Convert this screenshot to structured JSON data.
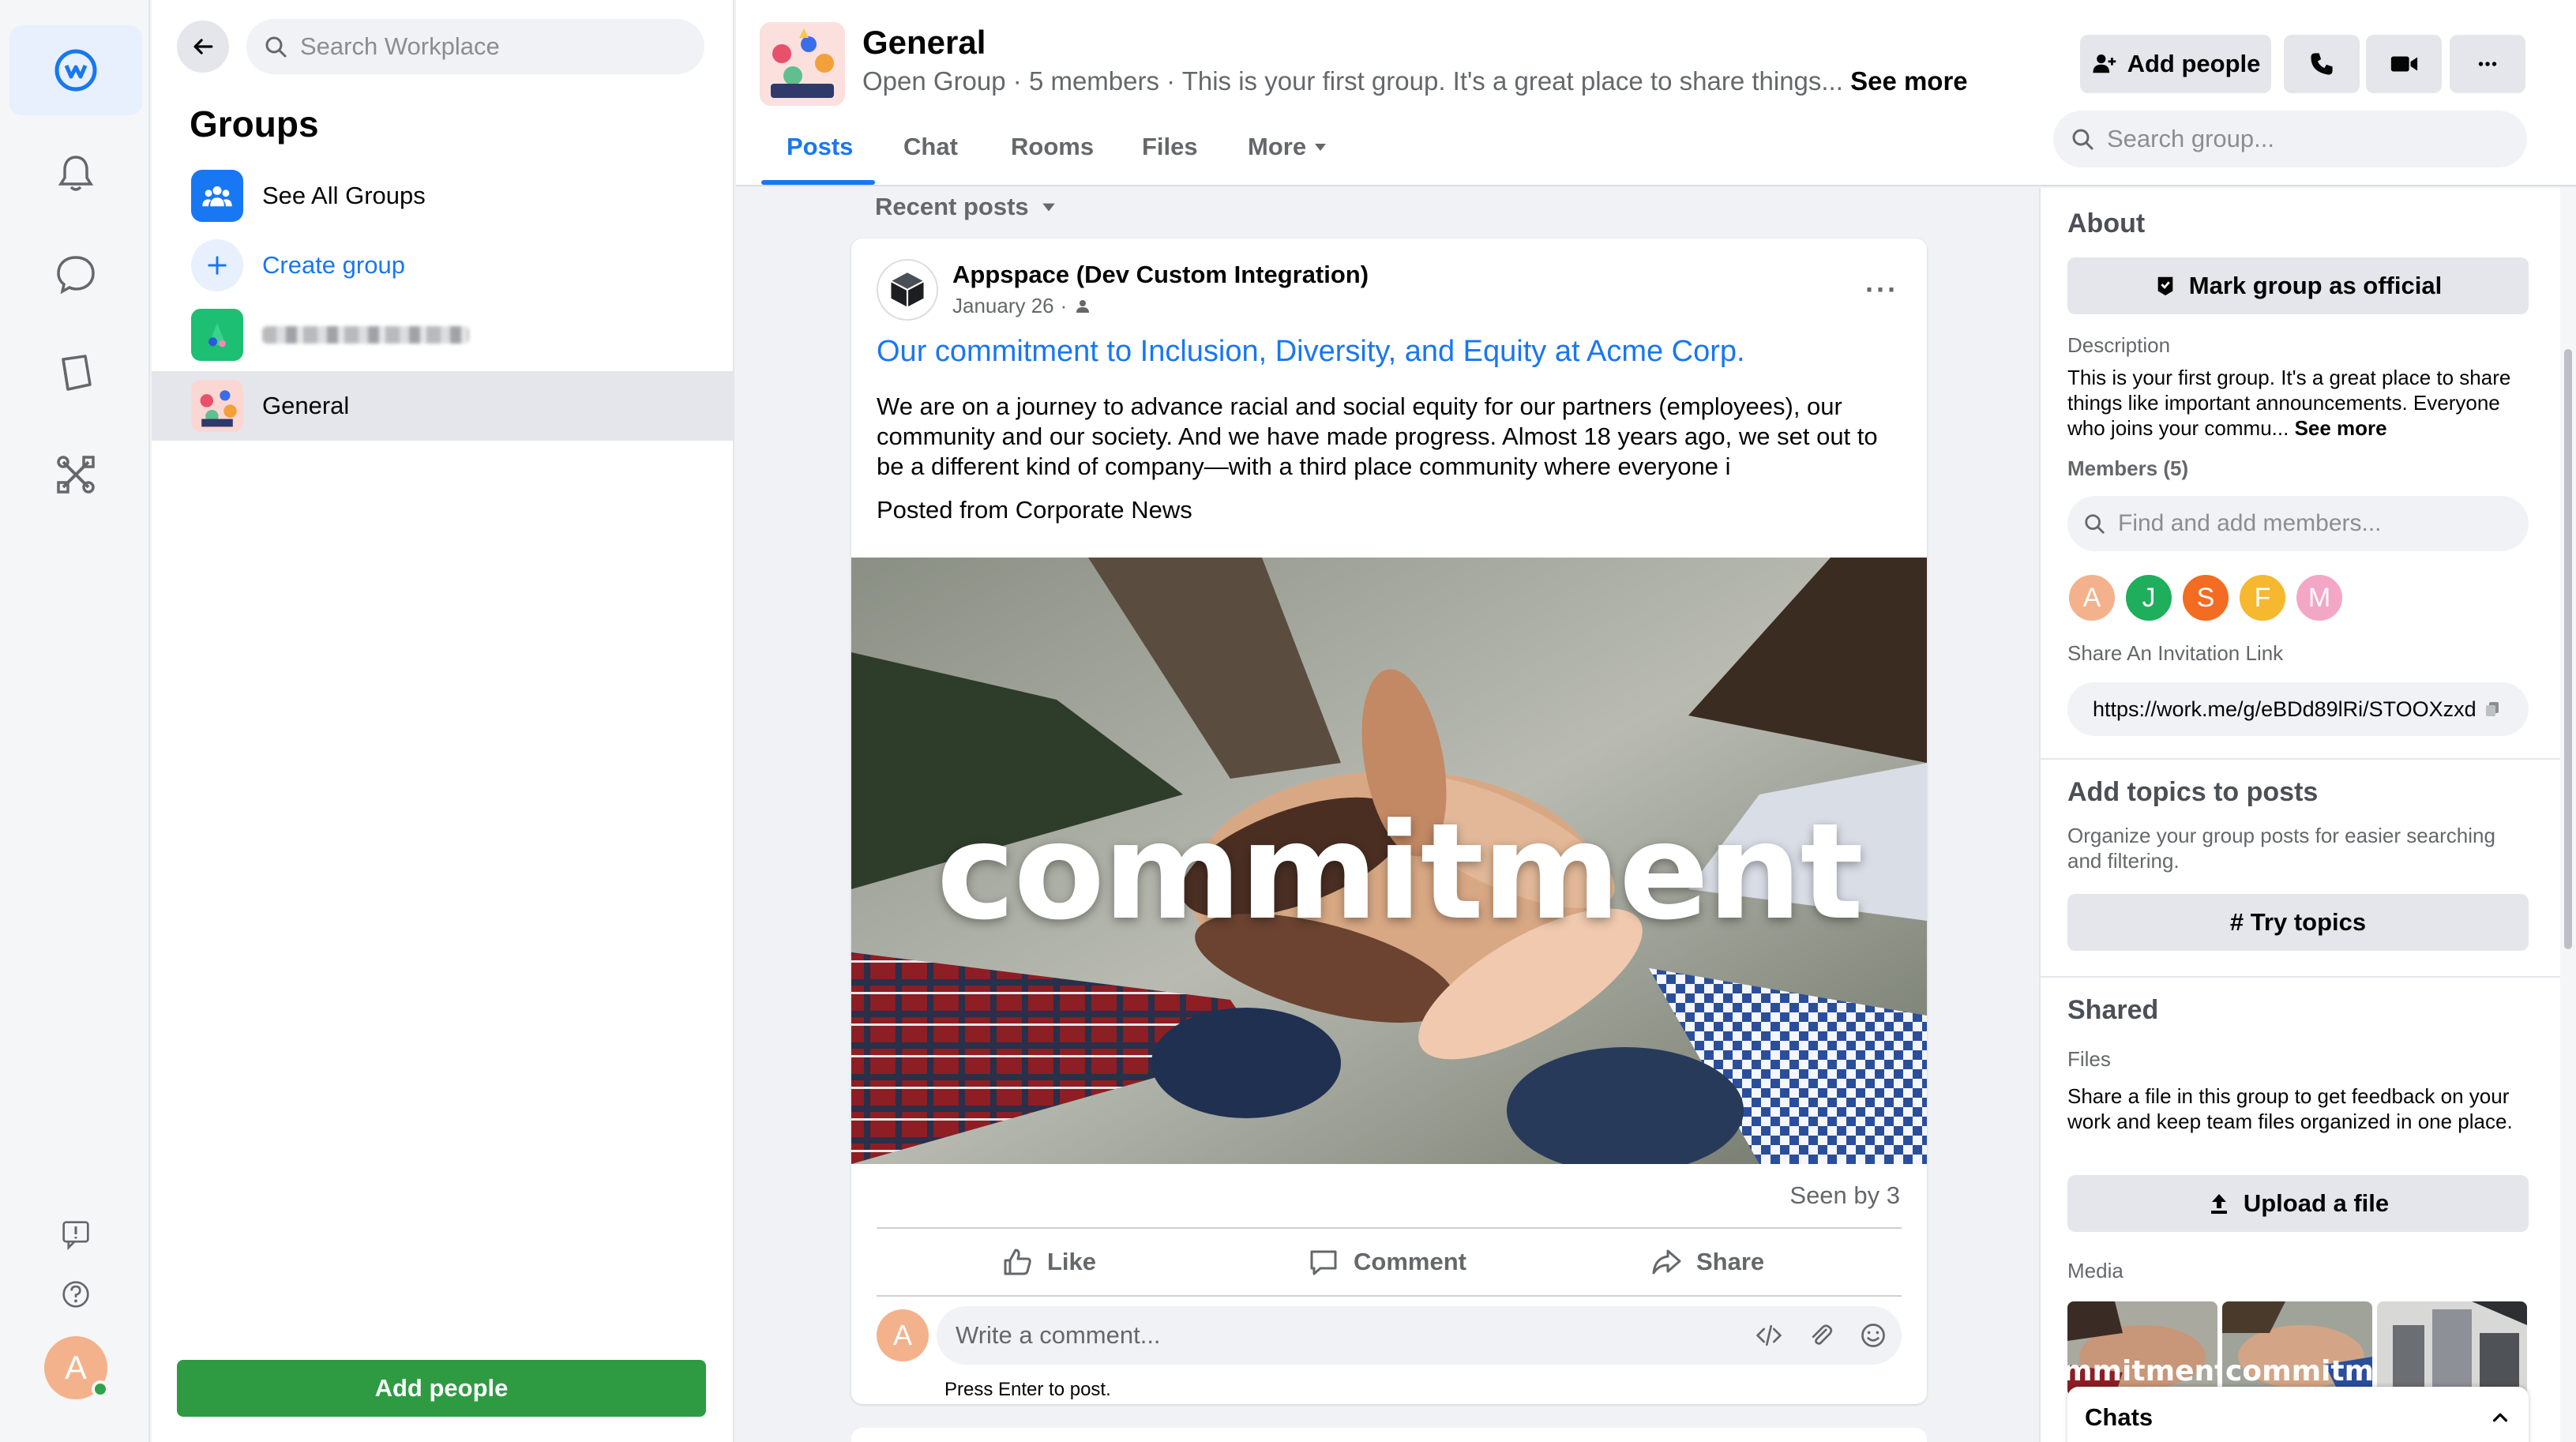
{
  "rail": {
    "items": [
      "workplace-logo",
      "notifications",
      "chats",
      "knowledge-library",
      "admin-tools"
    ],
    "bottom": [
      "feedback",
      "help"
    ],
    "user_initial": "A",
    "accent": "#1877f2"
  },
  "groups_panel": {
    "search_placeholder": "Search Workplace",
    "title": "Groups",
    "see_all": "See All Groups",
    "create": "Create group",
    "active_group": "General",
    "add_people": "Add people"
  },
  "header": {
    "name": "General",
    "meta": "Open Group · 5 members · This is your first group. It's a great place to share things...",
    "see_more": "See more",
    "add_people": "Add people",
    "tabs": [
      "Posts",
      "Chat",
      "Rooms",
      "Files",
      "More"
    ],
    "active_tab": "Posts",
    "search_placeholder": "Search group..."
  },
  "feed": {
    "sort_label": "Recent posts",
    "post": {
      "author": "Appspace (Dev Custom Integration)",
      "date": "January 26",
      "title": "Our commitment to Inclusion, Diversity, and Equity at Acme Corp.",
      "body": "We are on a journey to advance racial and social equity for our partners (employees), our community and our society. And we have made progress. Almost 18 years ago, we set out to be a different kind of company—with a third place community where everyone i",
      "source": "Posted from Corporate News",
      "image_text": "commitment",
      "seen": "Seen by 3",
      "actions": [
        "Like",
        "Comment",
        "Share"
      ],
      "comment_placeholder": "Write a comment...",
      "comment_hint": "Press Enter to post.",
      "commenter_initial": "A"
    }
  },
  "right_panel": {
    "about": "About",
    "mark_official": "Mark group as official",
    "description_label": "Description",
    "description": "This is your first group. It's a great place to share things like important announcements. Everyone who joins your commu...",
    "see_more": "See more",
    "members_label": "Members (5)",
    "members_search": "Find and add members...",
    "members": [
      {
        "initial": "A",
        "color": "#f3b28b"
      },
      {
        "initial": "J",
        "color": "#1fae5b"
      },
      {
        "initial": "S",
        "color": "#f36c21"
      },
      {
        "initial": "F",
        "color": "#f5b82e"
      },
      {
        "initial": "M",
        "color": "#f4a6c7"
      }
    ],
    "invite_label": "Share An Invitation Link",
    "invite_link": "https://work.me/g/eBDd89lRi/STOOXzxd",
    "topics_title": "Add topics to posts",
    "topics_desc": "Organize your group posts for easier searching and filtering.",
    "try_topics": "# Try topics",
    "shared_title": "Shared",
    "files_label": "Files",
    "files_desc": "Share a file in this group to get feedback on your work and keep team files organized in one place.",
    "upload": "Upload a file",
    "media_label": "Media",
    "chats": "Chats"
  }
}
